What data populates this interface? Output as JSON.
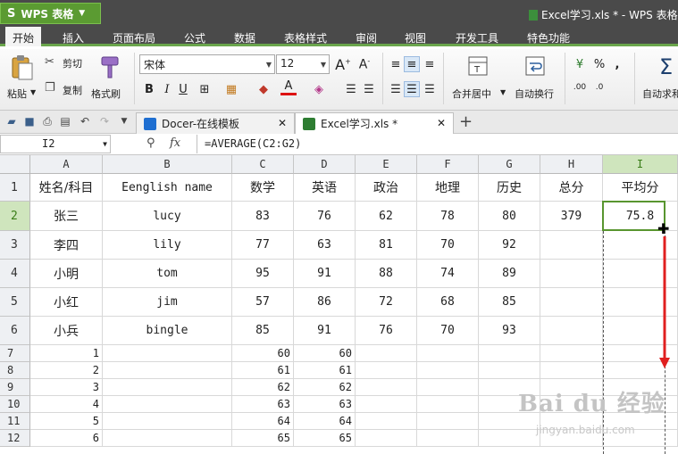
{
  "app": {
    "brand_label": "WPS 表格",
    "logo_glyph": "S",
    "doc_title": "Excel学习.xls * - WPS 表格"
  },
  "menu": [
    "开始",
    "插入",
    "页面布局",
    "公式",
    "数据",
    "表格样式",
    "审阅",
    "视图",
    "开发工具",
    "特色功能"
  ],
  "ribbon": {
    "paste": "粘贴",
    "cut": "剪切",
    "copy": "复制",
    "format_painter": "格式刷",
    "font_name": "宋体",
    "font_size": "12",
    "bold": "B",
    "italic": "I",
    "underline": "U",
    "merge_center": "合并居中",
    "wrap_text": "自动换行",
    "auto_sum": "自动求和",
    "percent": "%",
    "comma": ","
  },
  "tabs": [
    {
      "label": "Docer-在线模板"
    },
    {
      "label": "Excel学习.xls *"
    }
  ],
  "name_box": "I2",
  "fx_label": "fx",
  "formula": "=AVERAGE(C2:G2)",
  "columns": [
    "A",
    "B",
    "C",
    "D",
    "E",
    "F",
    "G",
    "H",
    "I"
  ],
  "header_row": [
    "姓名/科目",
    "Eenglish name",
    "数学",
    "英语",
    "政治",
    "地理",
    "历史",
    "总分",
    "平均分"
  ],
  "students": [
    [
      "张三",
      "lucy",
      "83",
      "76",
      "62",
      "78",
      "80",
      "379",
      "75.8"
    ],
    [
      "李四",
      "lily",
      "77",
      "63",
      "81",
      "70",
      "92",
      "",
      ""
    ],
    [
      "小明",
      "tom",
      "95",
      "91",
      "88",
      "74",
      "89",
      "",
      ""
    ],
    [
      "小红",
      "jim",
      "57",
      "86",
      "72",
      "68",
      "85",
      "",
      ""
    ],
    [
      "小兵",
      "bingle",
      "85",
      "91",
      "76",
      "70",
      "93",
      "",
      ""
    ]
  ],
  "extra_rows": [
    [
      "1",
      "60",
      "60"
    ],
    [
      "2",
      "61",
      "61"
    ],
    [
      "3",
      "62",
      "62"
    ],
    [
      "4",
      "63",
      "63"
    ],
    [
      "5",
      "64",
      "64"
    ],
    [
      "6",
      "65",
      "65"
    ]
  ],
  "row_numbers": [
    "1",
    "2",
    "3",
    "4",
    "5",
    "6",
    "7",
    "8",
    "9",
    "10",
    "11",
    "12"
  ],
  "watermark": "Bai du 经验",
  "watermark_url": "jingyan.baidu.com",
  "colors": {
    "accent": "#58952f",
    "title_bg": "#4a4a4a",
    "annotation_arrow": "#e02020"
  }
}
